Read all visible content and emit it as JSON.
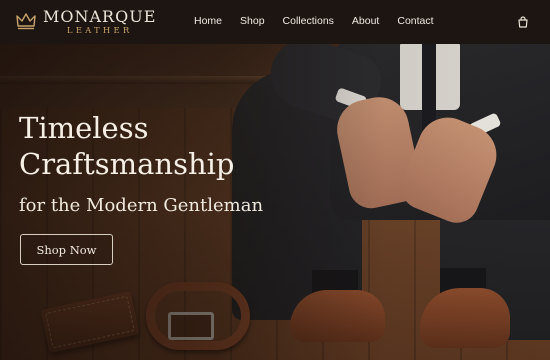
{
  "brand": {
    "name": "MONARQUE",
    "subtitle": "LEATHER",
    "logo_icon": "crown-icon",
    "accent_color": "#c7a36b"
  },
  "nav": {
    "items": [
      {
        "label": "Home"
      },
      {
        "label": "Shop"
      },
      {
        "label": "Collections"
      },
      {
        "label": "About"
      },
      {
        "label": "Contact"
      }
    ],
    "cart_icon": "shopping-bag-icon"
  },
  "hero": {
    "title_line1": "Timeless",
    "title_line2": "Craftsmanship",
    "tagline": "for the Modern Gentleman",
    "cta_label": "Shop Now"
  }
}
